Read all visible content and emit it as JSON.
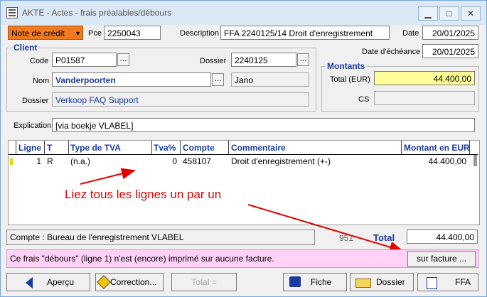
{
  "window": {
    "title": "AKTE - Actes - frais préalables/débours",
    "min": "▁",
    "max": "□",
    "close": "✕"
  },
  "header": {
    "type_value": "Note de crédit",
    "type_arrow": "▼",
    "pce_label": "Pce",
    "pce_value": "2250043",
    "description_label": "Description",
    "description_value": "FFA 2240125/14 Droit d'enregistrement",
    "date_label": "Date",
    "date_value": "20/01/2025",
    "due_label": "Date d'échéance",
    "due_value": "20/01/2025"
  },
  "client": {
    "group_title": "Client",
    "code_label": "Code",
    "code_value": "P01587",
    "dossier_label": "Dossier",
    "dossier_value": "2240125",
    "nom_label": "Nom",
    "nom_value": "Vanderpoorten",
    "jano": "Jano",
    "dossier2_label": "Dossier",
    "dossier2_value": "Verkoop FAQ Support",
    "dots": "..."
  },
  "montants": {
    "group_title": "Montants",
    "total_label": "Total (EUR)",
    "total_value": "44.400,00",
    "cs_label": "CS"
  },
  "explication": {
    "label": "Explication",
    "value": "[via boekje VLABEL]"
  },
  "table": {
    "headers": [
      "Ligne",
      "T",
      "Type de TVA",
      "Tva%",
      "Compte",
      "Commentaire",
      "Montant en EUR"
    ],
    "rows": [
      {
        "ligne": "1",
        "t": "R",
        "type": "(n.a.)",
        "tva": "0",
        "compte": "458107",
        "commentaire": "Droit d'enregistrement (+-)",
        "montant": "44.400,00"
      }
    ]
  },
  "annotation": "Liez tous les lignes un par un",
  "footer": {
    "compte_text": "Compte : Bureau de l'enregistrement VLABEL",
    "code": "951",
    "total_label": "Total",
    "total_value": "44.400,00",
    "warning": "Ce frais \"débours\" (ligne 1) n'est (encore) imprimé sur aucune facture.",
    "sur_facture": "sur facture ..."
  },
  "buttons": {
    "apercu": "Aperçu",
    "correction": "Correction...",
    "total": "Total =",
    "fiche": "Fiche",
    "dossier": "Dossier",
    "ffa": "FFA"
  },
  "colors": {
    "type_bg": "#f07a1f",
    "total_bg": "#ffff99",
    "warning_bg": "#ffd1f7",
    "header_blue": "#1b3aa0",
    "annot_red": "#e30000"
  }
}
